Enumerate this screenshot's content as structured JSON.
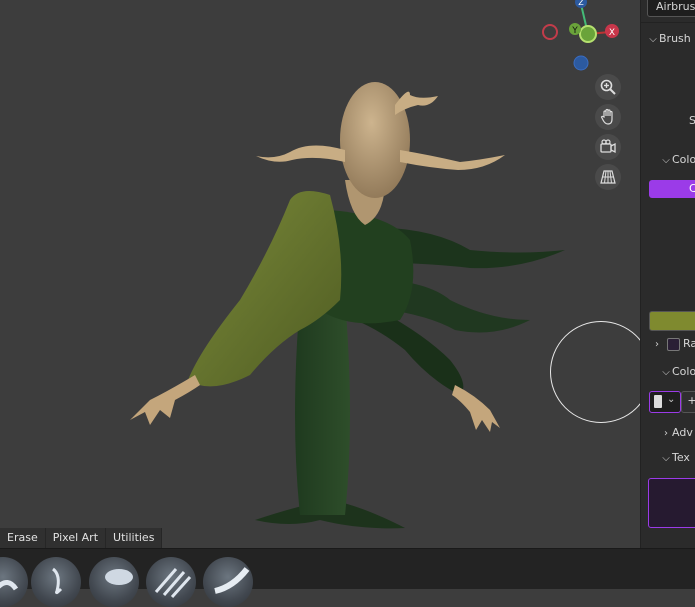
{
  "header": {
    "brush_name": "Airbrush"
  },
  "panel": {
    "brush_label": "Brush",
    "s_label": "S",
    "color_label": "Colo",
    "color_button_label": "C",
    "primary_color": "#9b3be8",
    "secondary_color": "#7f8a2f",
    "ra_label": "Ra",
    "color2_label": "Colo",
    "advanced_label": "Adv",
    "texture_label": "Tex",
    "plus_label": "+"
  },
  "gizmo": {
    "x_label": "X",
    "y_label": "Y",
    "z_label": "Z"
  },
  "bottom_tabs": [
    "Erase",
    "Pixel Art",
    "Utilities"
  ],
  "icons": [
    "zoom-icon",
    "hand-icon",
    "camera-icon",
    "grid-icon"
  ]
}
